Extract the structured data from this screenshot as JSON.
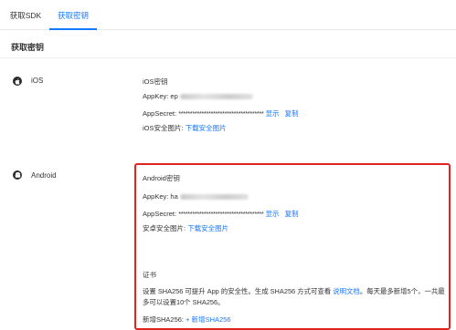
{
  "tabs": [
    {
      "label": "获取SDK",
      "active": false
    },
    {
      "label": "获取密钥",
      "active": true
    }
  ],
  "page": {
    "section_title": "获取密钥"
  },
  "ios": {
    "platform_label": "iOS",
    "block_title": "iOS密钥",
    "appkey_label": "AppKey: ep",
    "appsecret_label": "AppSecret: ",
    "appsecret_mask": "*************************************",
    "show_link": "显示",
    "copy_link": "复制",
    "security_image_label": "iOS安全图片:",
    "download_link": "下载安全图片"
  },
  "android": {
    "platform_label": "Android",
    "block_title": "Android密钥",
    "appkey_label": "AppKey: ha",
    "appsecret_label": "AppSecret: ",
    "appsecret_mask": "*************************************",
    "show_link": "显示",
    "copy_link": "复制",
    "security_image_label": "安卓安全图片:",
    "download_link": "下载安全图片",
    "cert_title": "证书",
    "cert_desc_part1": "设置 SHA256 可提升 App 的安全性。生成 SHA256 方式可查看",
    "cert_desc_link": "说明文档",
    "cert_desc_part2": "。每天最多新增5个，一共最",
    "cert_desc_line2": "多可以设置10个 SHA256。",
    "add_sha_label": "新增SHA256:",
    "add_sha_link": "+ 新增SHA256"
  },
  "colors": {
    "accent": "#1677ff",
    "highlight": "#e0231c"
  },
  "icons": {
    "ios": "apple-icon",
    "android": "android-icon"
  }
}
